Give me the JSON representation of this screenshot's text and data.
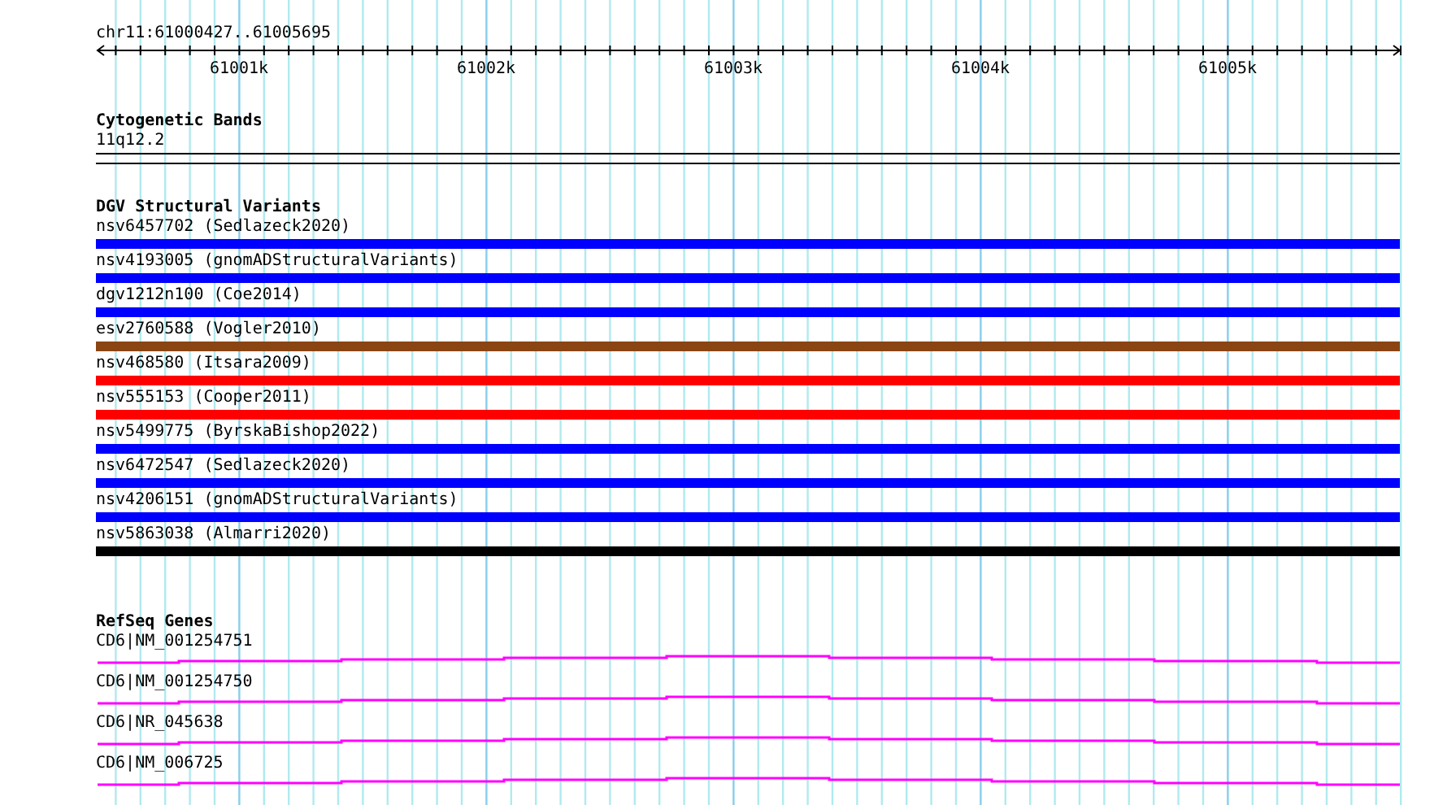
{
  "ruler": {
    "location": "chr11:61000427..61005695",
    "ticks": [
      "61001k",
      "61002k",
      "61003k",
      "61004k",
      "61005k"
    ]
  },
  "tracks": [
    {
      "kind": "bands",
      "title": "Cytogenetic Bands",
      "features": [
        {
          "label": "11q12.2"
        }
      ]
    },
    {
      "kind": "variants",
      "title": "DGV Structural Variants",
      "features": [
        {
          "label": "nsv6457702 (Sedlazeck2020)",
          "color": "#0000ff"
        },
        {
          "label": "nsv4193005 (gnomADStructuralVariants)",
          "color": "#0000ff"
        },
        {
          "label": "dgv1212n100 (Coe2014)",
          "color": "#0000ff"
        },
        {
          "label": "esv2760588 (Vogler2010)",
          "color": "#8b4513"
        },
        {
          "label": "nsv468580 (Itsara2009)",
          "color": "#ff0000"
        },
        {
          "label": "nsv555153 (Cooper2011)",
          "color": "#ff0000"
        },
        {
          "label": "nsv5499775 (ByrskaBishop2022)",
          "color": "#0000ff"
        },
        {
          "label": "nsv6472547 (Sedlazeck2020)",
          "color": "#0000ff"
        },
        {
          "label": "nsv4206151 (gnomADStructuralVariants)",
          "color": "#0000ff"
        },
        {
          "label": "nsv5863038 (Almarri2020)",
          "color": "#000000"
        }
      ]
    },
    {
      "kind": "genes",
      "title": "RefSeq Genes",
      "features": [
        {
          "label": "CD6|NM_001254751"
        },
        {
          "label": "CD6|NM_001254750"
        },
        {
          "label": "CD6|NR_045638"
        },
        {
          "label": "CD6|NM_006725"
        }
      ]
    }
  ]
}
